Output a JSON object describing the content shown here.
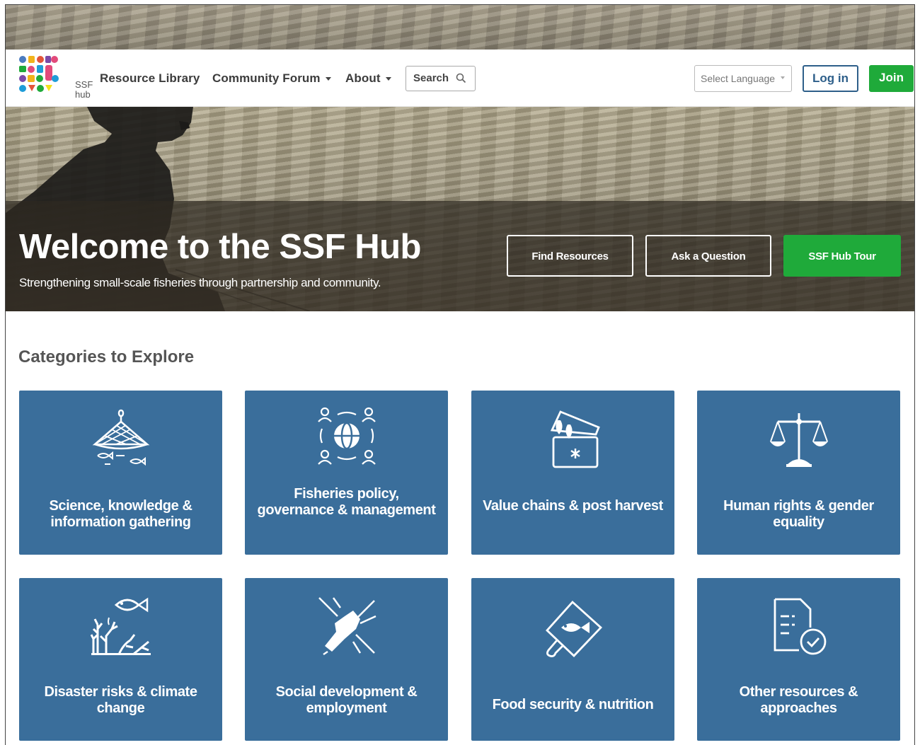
{
  "logo": {
    "text_line1": "SSF",
    "text_line2": "hub"
  },
  "nav": {
    "resource_library": "Resource Library",
    "community_forum": "Community Forum",
    "about": "About",
    "search_label": "Search",
    "language_select": "Select Language",
    "login": "Log in",
    "join": "Join"
  },
  "hero": {
    "title": "Welcome to the SSF Hub",
    "subtitle": "Strengthening small-scale fisheries through partnership and community.",
    "buttons": {
      "find": "Find Resources",
      "ask": "Ask a Question",
      "tour": "SSF Hub Tour"
    }
  },
  "categories": {
    "heading": "Categories to Explore",
    "items": [
      {
        "label": "Science, knowledge & information gathering",
        "icon": "fishing-net-icon"
      },
      {
        "label": "Fisheries policy, governance & management",
        "icon": "globe-people-icon"
      },
      {
        "label": "Value chains & post harvest",
        "icon": "fish-cooler-icon"
      },
      {
        "label": "Human rights & gender equality",
        "icon": "scales-icon"
      },
      {
        "label": "Disaster risks & climate change",
        "icon": "coral-fish-icon"
      },
      {
        "label": "Social development & employment",
        "icon": "joined-hands-icon"
      },
      {
        "label": "Food security & nutrition",
        "icon": "fish-cutting-board-icon"
      },
      {
        "label": "Other resources & approaches",
        "icon": "document-check-icon"
      }
    ]
  },
  "colors": {
    "card_blue": "#3a6e9b",
    "green": "#1faa3a",
    "login_blue": "#2e5f8a"
  }
}
